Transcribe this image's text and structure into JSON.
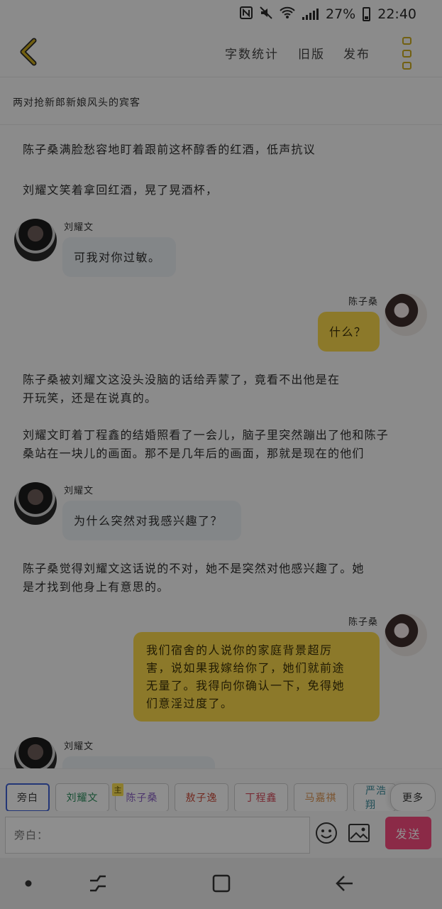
{
  "status_bar": {
    "battery_percent": "27%",
    "time": "22:40"
  },
  "top_bar": {
    "actions": [
      "字数统计",
      "旧版",
      "发布"
    ]
  },
  "story_title": "两对抢新郎新娘风头的宾客",
  "messages": [
    {
      "type": "narration",
      "text": "陈子桑满脸愁容地盯着跟前这杯醇香的红酒，低声抗议"
    },
    {
      "type": "narration",
      "text": "刘耀文笑着拿回红酒，晃了晃酒杯，"
    },
    {
      "type": "dialogue",
      "side": "left",
      "speaker": "刘耀文",
      "text": "可我对你过敏。"
    },
    {
      "type": "dialogue",
      "side": "right",
      "speaker": "陈子桑",
      "text": "什么？"
    },
    {
      "type": "narration",
      "lines": [
        "陈子桑被刘耀文这没头没脑的话给弄蒙了，竟看不出他是在",
        "开玩笑，还是在说真的。"
      ]
    },
    {
      "type": "narration",
      "lines": [
        "刘耀文盯着丁程鑫的结婚照看了一会儿，脑子里突然蹦出了他和陈子",
        "桑站在一块儿的画面。那不是几年后的画面，那就是现在的他们"
      ]
    },
    {
      "type": "dialogue",
      "side": "left",
      "speaker": "刘耀文",
      "text": "为什么突然对我感兴趣了？"
    },
    {
      "type": "narration",
      "lines": [
        "陈子桑觉得刘耀文这话说的不对，她不是突然对他感兴趣了。她",
        "是才找到他身上有意思的。"
      ]
    },
    {
      "type": "dialogue",
      "side": "right",
      "speaker": "陈子桑",
      "lines": [
        "我们宿舍的人说你的家庭背景超厉",
        "害，说如果我嫁给你了，她们就前途",
        "无量了。我得向你确认一下，免得她",
        "们意淫过度了。"
      ]
    },
    {
      "type": "dialogue",
      "side": "left",
      "speaker": "刘耀文",
      "text": ""
    }
  ],
  "characters": {
    "narration": "旁白",
    "list": [
      "刘耀文",
      "陈子桑",
      "敖子逸",
      "丁程鑫",
      "马嘉祺",
      "严浩翔"
    ],
    "main_badge": "主",
    "more": "更多"
  },
  "input": {
    "placeholder": "旁白：",
    "send_label": "发送"
  },
  "colors": {
    "accent_yellow": "#f7d54a",
    "send_button": "#f44a7e",
    "narration_chip_border": "#3f5fcf",
    "back_arrow": "#c9a91e"
  },
  "icons": [
    "nfc-icon",
    "mute-icon",
    "wifi-icon",
    "signal-icon",
    "battery-icon",
    "back-arrow-icon",
    "more-menu-icon",
    "emoji-icon",
    "image-icon",
    "recent-apps-icon",
    "home-icon",
    "nav-back-icon"
  ]
}
